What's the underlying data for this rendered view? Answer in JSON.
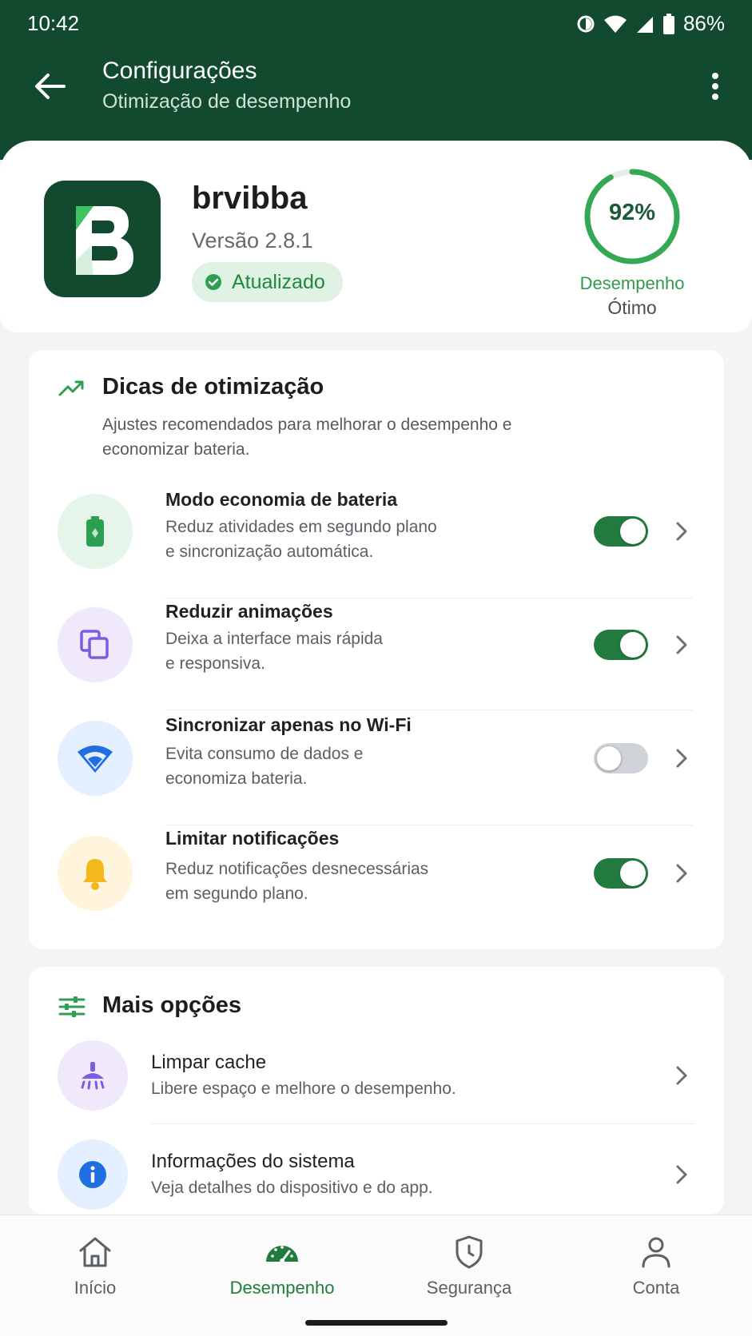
{
  "status_bar": {
    "time": "10:42",
    "battery": "86%"
  },
  "appbar": {
    "title": "Configurações",
    "subtitle": "Otimização de desempenho"
  },
  "app": {
    "name": "brvibba",
    "version": "Versão 2.8.1",
    "badge": "Atualizado",
    "performance_value": "92%",
    "performance_fraction": 0.92,
    "performance_label": "Desempenho",
    "performance_status": "Ótimo"
  },
  "tips": {
    "title": "Dicas de otimização",
    "description": "Ajustes recomendados para melhorar o desempenho e economizar bateria.",
    "items": [
      {
        "title": "Modo economia de bateria",
        "desc_line1": "Reduz atividades em segundo plano",
        "desc_line2": "e sincronização automática.",
        "enabled": true,
        "icon": "battery-icon",
        "color": "#2e9f52"
      },
      {
        "title": "Reduzir animações",
        "desc_line1": "Deixa a interface mais rápida",
        "desc_line2": "e responsiva.",
        "enabled": true,
        "icon": "layers-icon",
        "color": "#7c5ce0"
      },
      {
        "title": "Sincronizar apenas no Wi-Fi",
        "desc_line1": "Evita consumo de dados e",
        "desc_line2": "economiza bateria.",
        "enabled": false,
        "icon": "wifi-icon",
        "color": "#1f6fe0"
      },
      {
        "title": "Limitar notificações",
        "desc_line1": "Reduz notificações desnecessárias",
        "desc_line2": "em segundo plano.",
        "enabled": true,
        "icon": "bell-icon",
        "color": "#f2b81c"
      }
    ]
  },
  "more_options": {
    "title": "Mais opções",
    "items": [
      {
        "title": "Limpar cache",
        "desc": "Libere espaço e melhore o desempenho.",
        "icon": "broom-icon"
      },
      {
        "title": "Informações do sistema",
        "desc": "Veja detalhes do dispositivo e do app.",
        "icon": "info-icon"
      }
    ]
  },
  "bottom_nav": [
    {
      "label": "Início",
      "icon": "home-icon",
      "active": false
    },
    {
      "label": "Desempenho",
      "icon": "speedometer-icon",
      "active": true
    },
    {
      "label": "Segurança",
      "icon": "shield-icon",
      "active": false
    },
    {
      "label": "Conta",
      "icon": "person-icon",
      "active": false
    }
  ],
  "colors": {
    "header": "#124a30",
    "accent": "#237a3e",
    "background": "#f3f4f6"
  }
}
